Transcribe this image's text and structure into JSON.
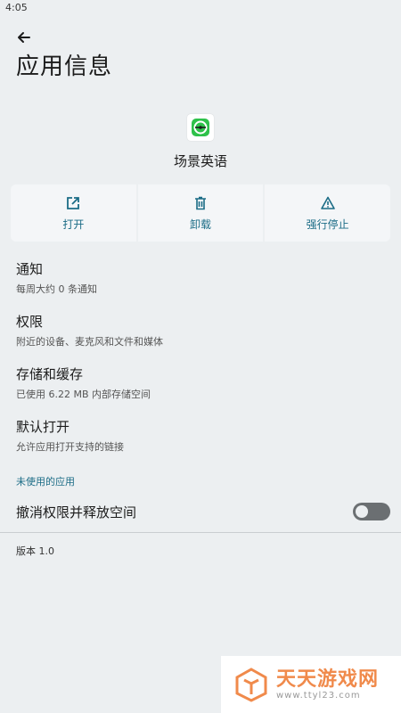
{
  "status_bar": {
    "time": "4:05"
  },
  "header": {
    "title": "应用信息"
  },
  "app": {
    "name": "场景英语"
  },
  "actions": [
    {
      "label": "打开",
      "icon": "open-in-new-icon"
    },
    {
      "label": "卸载",
      "icon": "trash-icon"
    },
    {
      "label": "强行停止",
      "icon": "warning-icon"
    }
  ],
  "items": [
    {
      "title": "通知",
      "subtitle": "每周大约 0 条通知"
    },
    {
      "title": "权限",
      "subtitle": "附近的设备、麦克风和文件和媒体"
    },
    {
      "title": "存储和缓存",
      "subtitle": "已使用 6.22 MB 内部存储空间"
    },
    {
      "title": "默认打开",
      "subtitle": "允许应用打开支持的链接"
    }
  ],
  "unused": {
    "section_title": "未使用的应用",
    "toggle_label": "撤消权限并释放空间",
    "enabled": false
  },
  "version": "版本 1.0",
  "watermark": {
    "main": "天天游戏网",
    "sub": "www.ttyl23.com"
  },
  "colors": {
    "accent": "#1b6c86",
    "background": "#eceff1",
    "watermark": "#f08a4b"
  }
}
